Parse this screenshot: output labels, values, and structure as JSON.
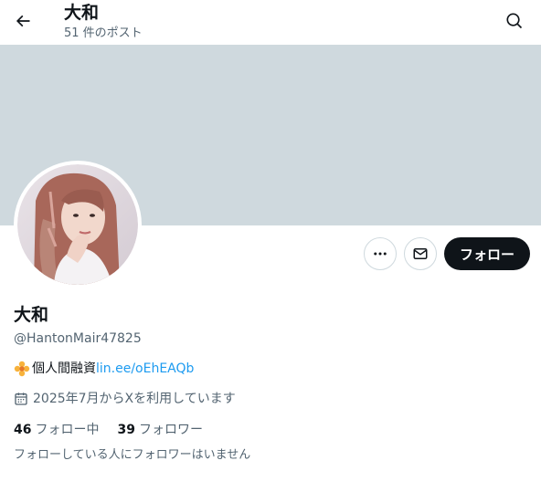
{
  "header": {
    "title": "大和",
    "post_count": "51 件のポスト"
  },
  "banner": {
    "color": "#cfd9de"
  },
  "profile": {
    "display_name": "大和",
    "handle": "@HantonMair47825",
    "bio_prefix": "個人間融資",
    "bio_link": "lin.ee/oEhEAQb",
    "joined": "2025年7月からXを利用しています",
    "following_count": "46",
    "following_label": "フォロー中",
    "followers_count": "39",
    "followers_label": "フォロワー",
    "followers_you_know": "フォローしている人にフォロワーはいません"
  },
  "actions": {
    "follow_label": "フォロー"
  },
  "icons": [
    "back-arrow-icon",
    "search-icon",
    "more-icon",
    "mail-icon",
    "flower-icon",
    "calendar-icon"
  ],
  "colors": {
    "accent": "#1d9bf0",
    "primary_button": "#0f1419",
    "secondary_text": "#536471"
  }
}
